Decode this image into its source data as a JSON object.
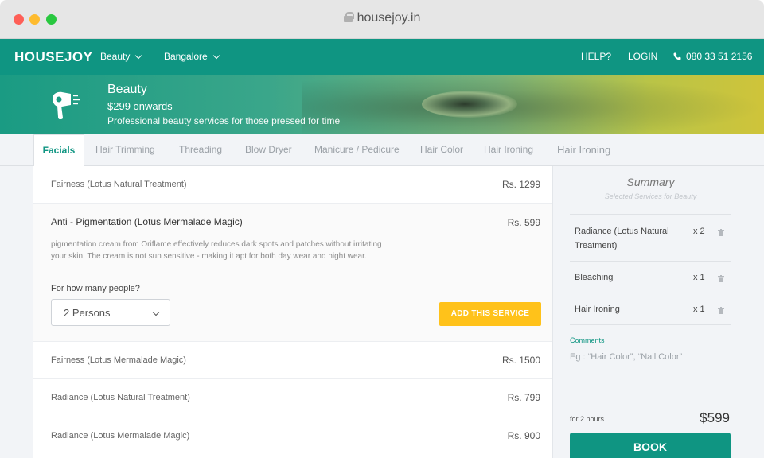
{
  "browser": {
    "url": "housejoy.in"
  },
  "nav": {
    "logo": "HOUSEJOY",
    "category": "Beauty",
    "city": "Bangalore",
    "help": "HELP?",
    "login": "LOGIN",
    "phone": "080 33 51 2156"
  },
  "hero": {
    "title": "Beauty",
    "price": "$299 onwards",
    "subtitle": "Professional beauty services for those pressed for time",
    "icon": "hair-dryer-icon"
  },
  "tabs": [
    "Facials",
    "Hair Trimming",
    "Threading",
    "Blow Dryer",
    "Manicure / Pedicure",
    "Hair Color",
    "Hair Ironing",
    "Hair Ironing"
  ],
  "services": [
    {
      "name": "Fairness (Lotus Natural Treatment)",
      "price": "Rs. 1299"
    },
    {
      "name": "Fairness (Lotus Mermalade Magic)",
      "price": "Rs. 1500"
    },
    {
      "name": "Radiance (Lotus Natural Treatment)",
      "price": "Rs. 799"
    },
    {
      "name": "Radiance (Lotus Mermalade Magic)",
      "price": "Rs. 900"
    }
  ],
  "expanded": {
    "title": "Anti - Pigmentation (Lotus Mermalade Magic)",
    "price": "Rs. 599",
    "description": "pigmentation cream from Oriflame effectively reduces dark spots and patches without irritating your skin. The cream is not sun sensitive - making it apt for both day wear and night wear.",
    "question": "For how many people?",
    "persons": "2 Persons",
    "add_button": "ADD THIS SERVICE"
  },
  "summary": {
    "title": "Summary",
    "subtitle": "Selected Services for Beauty",
    "items": [
      {
        "name": "Radiance (Lotus Natural Treatment)",
        "qty": "x 2"
      },
      {
        "name": "Bleaching",
        "qty": "x 1"
      },
      {
        "name": "Hair Ironing",
        "qty": "x 1"
      }
    ],
    "comments_label": "Comments",
    "comments_placeholder": "Eg : “Hair Color”, “Nail Color”",
    "duration": "for 2 hours",
    "total": "$599",
    "book": "BOOK"
  },
  "colors": {
    "brand": "#0f9582",
    "accent": "#ffc21a"
  }
}
